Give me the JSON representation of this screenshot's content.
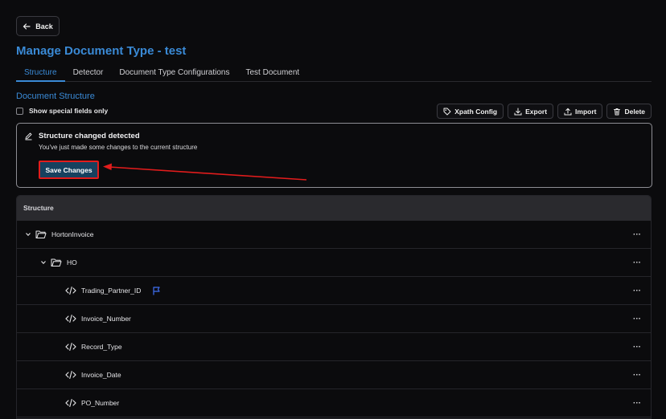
{
  "nav": {
    "back_label": "Back"
  },
  "page": {
    "title": "Manage Document Type - test"
  },
  "tabs": [
    {
      "label": "Structure",
      "active": true
    },
    {
      "label": "Detector",
      "active": false
    },
    {
      "label": "Document Type Configurations",
      "active": false
    },
    {
      "label": "Test Document",
      "active": false
    }
  ],
  "section": {
    "title": "Document Structure",
    "special_fields_label": "Show special fields only"
  },
  "toolbar": {
    "xpath_label": "Xpath Config",
    "export_label": "Export",
    "import_label": "Import",
    "delete_label": "Delete"
  },
  "notice": {
    "title": "Structure changed detected",
    "subtitle": "You've just made some changes to the current structure",
    "save_label": "Save Changes"
  },
  "table": {
    "header": "Structure",
    "rows": [
      {
        "label": "HortonInvoice",
        "type": "folder",
        "level": 0,
        "expanded": true
      },
      {
        "label": "HO",
        "type": "folder",
        "level": 1,
        "expanded": true
      },
      {
        "label": "Trading_Partner_ID",
        "type": "field",
        "level": 2,
        "flagged": true
      },
      {
        "label": "Invoice_Number",
        "type": "field",
        "level": 2
      },
      {
        "label": "Record_Type",
        "type": "field",
        "level": 2
      },
      {
        "label": "Invoice_Date",
        "type": "field",
        "level": 2
      },
      {
        "label": "PO_Number",
        "type": "field",
        "level": 2
      }
    ],
    "more_label": "···"
  },
  "colors": {
    "accent": "#3a8ad6",
    "save_button": "#16415f",
    "highlight_red": "#e21c1c",
    "flag_blue": "#3f6ff2"
  }
}
